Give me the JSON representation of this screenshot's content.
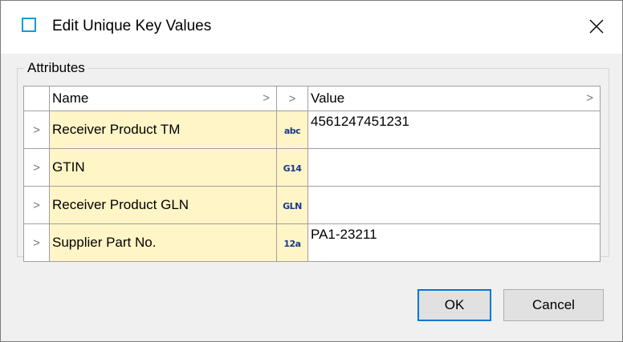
{
  "window": {
    "title": "Edit Unique Key Values",
    "icon": "window-app-icon",
    "close_icon": "close-icon"
  },
  "attributes": {
    "group_label": "Attributes",
    "columns": {
      "name": "Name",
      "value": "Value"
    },
    "rows": [
      {
        "name": "Receiver Product TM",
        "type_icon": "abc",
        "value": "4561247451231"
      },
      {
        "name": "GTIN",
        "type_icon": "G14",
        "value": ""
      },
      {
        "name": "Receiver Product GLN",
        "type_icon": "GLN",
        "value": ""
      },
      {
        "name": "Supplier Part No.",
        "type_icon": "12a",
        "value": "PA1-23211"
      }
    ]
  },
  "buttons": {
    "ok": "OK",
    "cancel": "Cancel"
  },
  "colors": {
    "accent": "#0078d7",
    "key_cell": "#fff5c6",
    "icon_border": "#1a9ad6"
  }
}
